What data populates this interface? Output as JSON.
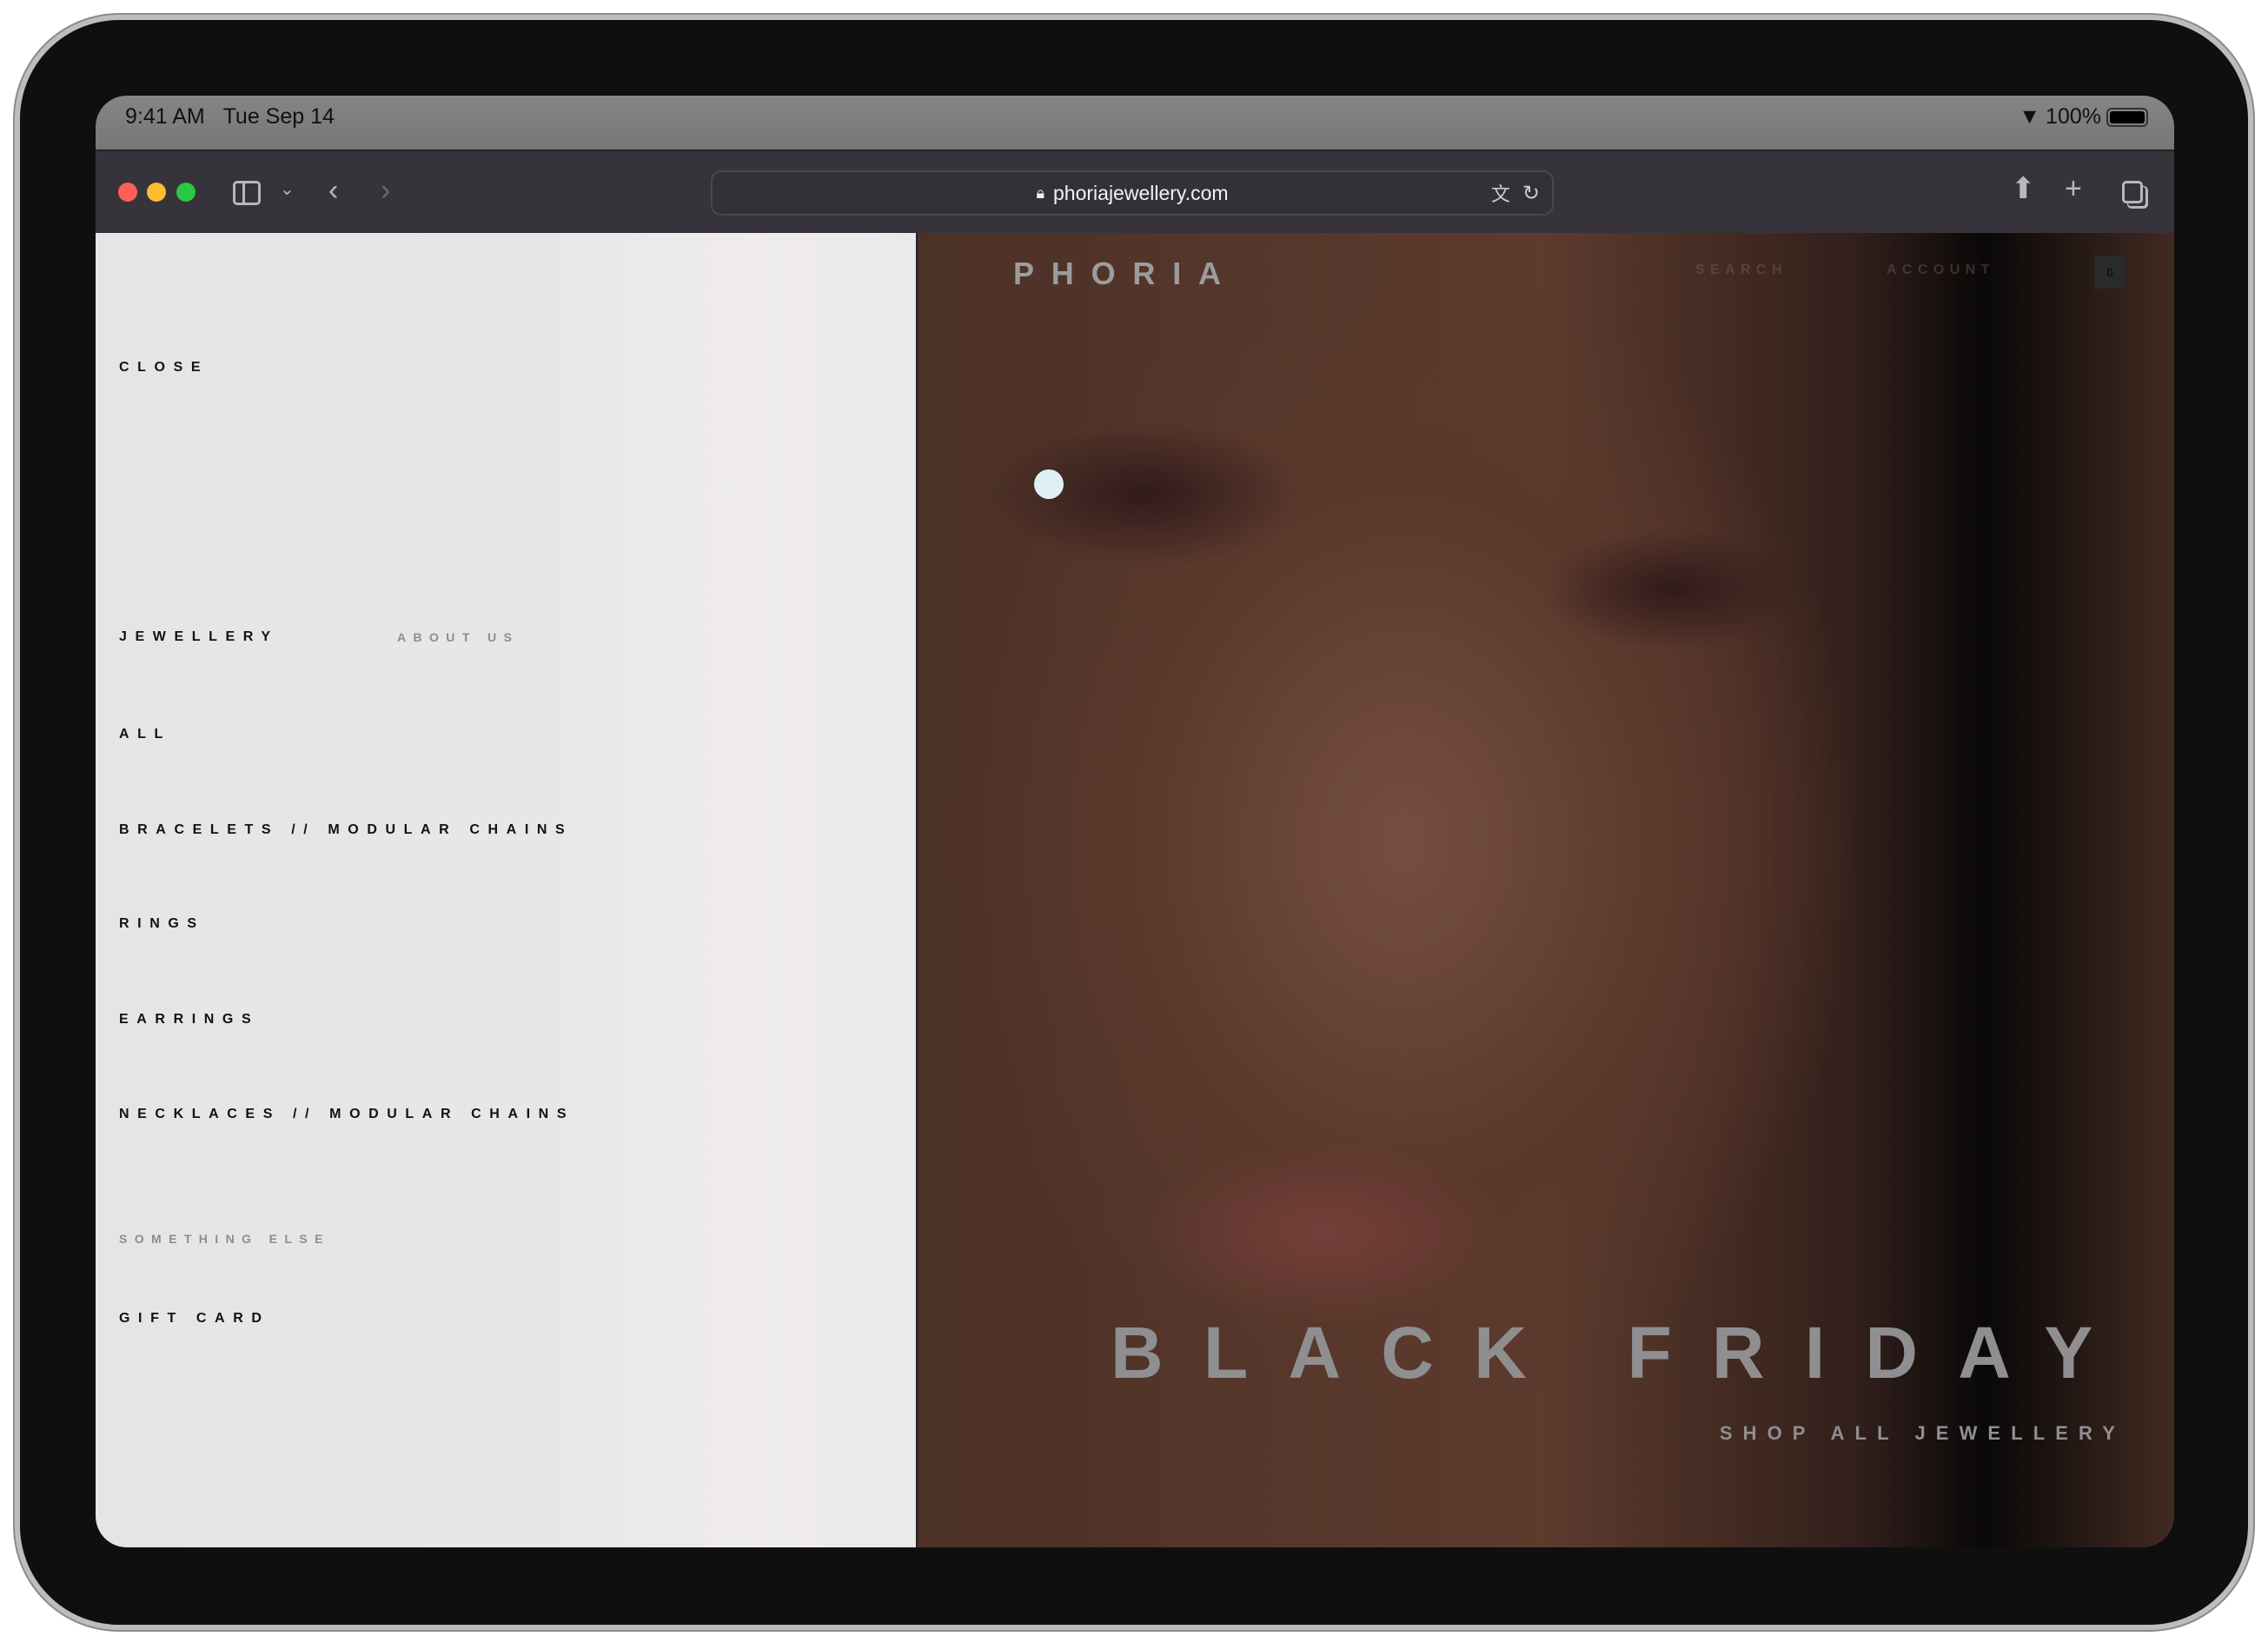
{
  "status_bar": {
    "time": "9:41 AM",
    "date": "Tue Sep 14",
    "battery": "100%",
    "battery_level": 1.0
  },
  "browser": {
    "url": "phoriajewellery.com",
    "icons": [
      "sidebar-icon",
      "chevron-down-icon",
      "back-icon",
      "forward-icon",
      "lock-icon",
      "translate-icon",
      "reload-icon",
      "share-icon",
      "plus-icon",
      "tabs-icon"
    ],
    "traffic_lights": {
      "close": "#ff5f57",
      "minimize": "#febc2e",
      "zoom": "#28c840"
    }
  },
  "menu": {
    "close": "CLOSE",
    "jewellery": "JEWELLERY",
    "about": "ABOUT US",
    "items": [
      "ALL",
      "BRACELETS // MODULAR CHAINS",
      "RINGS",
      "EARRINGS",
      "NECKLACES // MODULAR CHAINS"
    ],
    "section": "SOMETHING ELSE",
    "gift_card": "GIFT CARD"
  },
  "site": {
    "logo": "PHORIA",
    "search": "SEARCH",
    "account": "ACCOUNT",
    "cart_count": "0",
    "headline": "BLACK FRIDAY",
    "cta": "SHOP ALL JEWELLERY"
  }
}
